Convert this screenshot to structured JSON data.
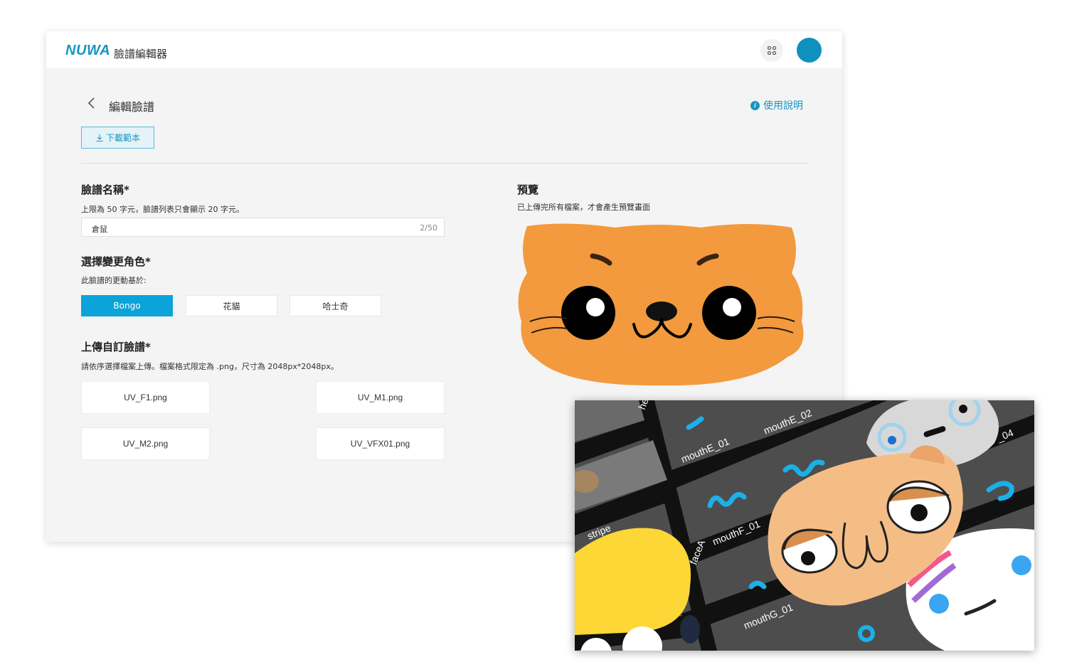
{
  "app": {
    "logo_text": "NUWA",
    "name": "臉譜編輯器"
  },
  "header": {
    "title": "編輯臉譜",
    "help_label": "使用說明",
    "download_label": "下載範本"
  },
  "face_name": {
    "title": "臉譜名稱*",
    "desc": "上限為 50 字元，臉譜列表只會顯示 20 字元。",
    "value": "倉鼠",
    "counter": "2/50"
  },
  "role": {
    "title": "選擇變更角色*",
    "desc": "此臉譜的更動基於:",
    "options": [
      {
        "label": "Bongo",
        "selected": true
      },
      {
        "label": "花貓",
        "selected": false
      },
      {
        "label": "哈士奇",
        "selected": false
      }
    ]
  },
  "upload": {
    "title": "上傳自訂臉譜*",
    "desc": "請依序選擇檔案上傳。檔案格式限定為 .png，尺寸為 2048px*2048px。",
    "files": [
      "UV_F1.png",
      "UV_M1.png",
      "UV_M2.png",
      "UV_VFX01.png"
    ]
  },
  "preview": {
    "title": "預覽",
    "desc": "已上傳完所有檔案，才會產生預覽畫面"
  },
  "texture_labels": [
    "mouthE_01",
    "mouthE_02",
    "mouthF_01",
    "mouthG_01",
    "stripe",
    "faceA",
    "he",
    "_04"
  ],
  "colors": {
    "accent": "#1597c2",
    "active_button": "#0aa4d8",
    "avatar": "#1090be",
    "cat_orange": "#f39a3e"
  }
}
